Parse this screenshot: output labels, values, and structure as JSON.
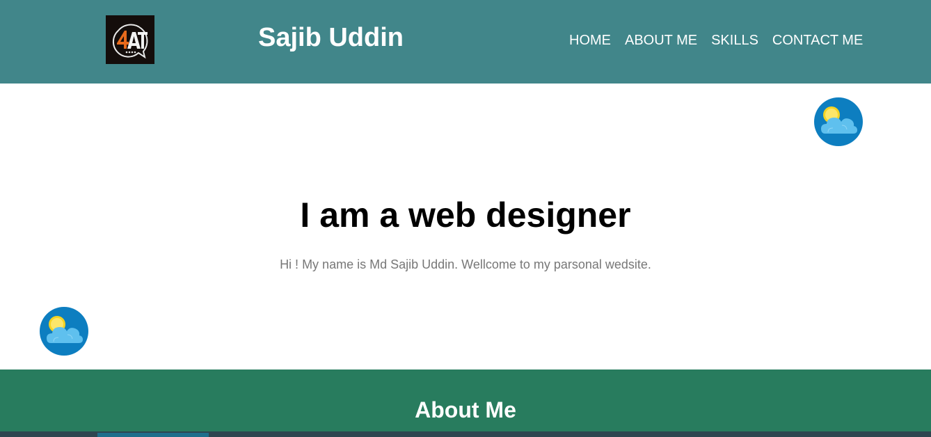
{
  "header": {
    "logo_icon": "4at-logo-icon",
    "title": "Sajib Uddin",
    "background": "#41868a",
    "nav": [
      {
        "label": "HOME"
      },
      {
        "label": "ABOUT ME"
      },
      {
        "label": "SKILLS"
      },
      {
        "label": "CONTACT ME"
      }
    ]
  },
  "hero": {
    "heading": "I am a web designer",
    "text": "Hi ! My name is Md Sajib Uddin. Wellcome to my parsonal wedsite.",
    "icons": [
      "sun-cloud-icon",
      "sun-cloud-icon"
    ]
  },
  "about": {
    "title": "About Me",
    "background": "#287c5e"
  }
}
